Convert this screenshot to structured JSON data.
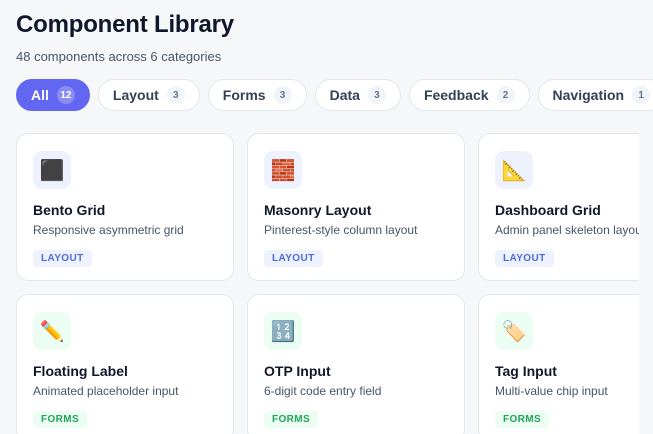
{
  "header": {
    "title": "Component Library",
    "subtitle": "48 components across 6 categories"
  },
  "tabs": [
    {
      "label": "All",
      "count": "12",
      "active": true
    },
    {
      "label": "Layout",
      "count": "3"
    },
    {
      "label": "Forms",
      "count": "3"
    },
    {
      "label": "Data",
      "count": "3"
    },
    {
      "label": "Feedback",
      "count": "2"
    },
    {
      "label": "Navigation",
      "count": "1"
    }
  ],
  "cards": [
    {
      "name": "Bento Grid",
      "desc": "Responsive asymmetric grid",
      "category": "LAYOUT",
      "icon": "black-square-icon",
      "glyph": "⬛"
    },
    {
      "name": "Masonry Layout",
      "desc": "Pinterest-style column layout",
      "category": "LAYOUT",
      "icon": "brick-icon",
      "glyph": "🧱"
    },
    {
      "name": "Dashboard Grid",
      "desc": "Admin panel skeleton layout",
      "category": "LAYOUT",
      "icon": "triangle-ruler-icon",
      "glyph": "📐"
    },
    {
      "name": "Floating Label",
      "desc": "Animated placeholder input",
      "category": "FORMS",
      "icon": "pencil-icon",
      "glyph": "✏️"
    },
    {
      "name": "OTP Input",
      "desc": "6-digit code entry field",
      "category": "FORMS",
      "icon": "numbers-icon",
      "glyph": "🔢"
    },
    {
      "name": "Tag Input",
      "desc": "Multi-value chip input",
      "category": "FORMS",
      "icon": "tag-icon",
      "glyph": "🏷️"
    }
  ],
  "colors": {
    "accent": "#6366f1",
    "layout_badge": "#4f6bd8",
    "forms_badge": "#22a55a"
  }
}
